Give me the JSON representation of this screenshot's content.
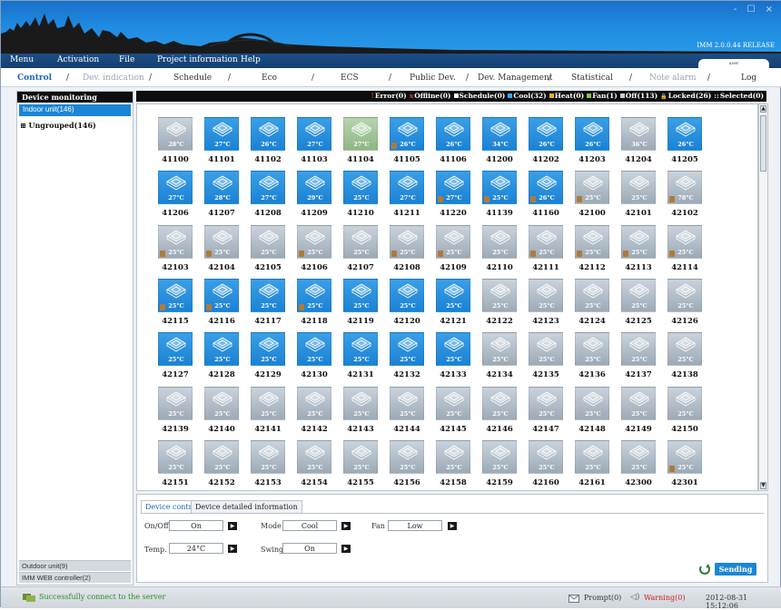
{
  "window": {
    "controls": "- ☐ ×",
    "version": "IMM 2.0.0.44 RELEASE"
  },
  "menu": [
    "Menu",
    "Activation",
    "File",
    "Project information",
    "Help"
  ],
  "user_tab": "user",
  "nav_tabs": [
    {
      "label": "Control",
      "state": "active"
    },
    {
      "label": "Dev. indication",
      "state": "dim"
    },
    {
      "label": "Schedule",
      "state": "normal"
    },
    {
      "label": "Eco",
      "state": "normal"
    },
    {
      "label": "ECS",
      "state": "normal"
    },
    {
      "label": "Public Dev.",
      "state": "normal"
    },
    {
      "label": "Dev. Management",
      "state": "normal"
    },
    {
      "label": "Statistical",
      "state": "normal"
    },
    {
      "label": "Note alarm",
      "state": "dim"
    },
    {
      "label": "Log",
      "state": "normal"
    }
  ],
  "left": {
    "title": "Device monitoring",
    "indoor": "Indoor unit(146)",
    "group": "Ungrouped(146)",
    "outdoor": "Outdoor unit(9)",
    "web": "IMM WEB controller(2)"
  },
  "status": [
    {
      "label": "Error(0)",
      "color": "#e23b3b",
      "glyph": "!"
    },
    {
      "label": "Offline(0)",
      "color": "#e23b3b",
      "glyph": "x"
    },
    {
      "label": "Schedule(0)",
      "color": "#ffffff",
      "glyph": "sq"
    },
    {
      "label": "Cool(32)",
      "color": "#37a8ff",
      "glyph": "sq"
    },
    {
      "label": "Heat(0)",
      "color": "#f0b400",
      "glyph": "sq"
    },
    {
      "label": "Fan(1)",
      "color": "#88c24f",
      "glyph": "sq"
    },
    {
      "label": "Off(113)",
      "color": "#c7ced6",
      "glyph": "sq"
    },
    {
      "label": "Locked(26)",
      "color": "#c79a55",
      "glyph": "lock"
    },
    {
      "label": "Selected(0)",
      "color": "#ffffff",
      "glyph": "dots"
    }
  ],
  "devices": [
    {
      "id": "41100",
      "temp": "28°C",
      "state": "off"
    },
    {
      "id": "41101",
      "temp": "27°C",
      "state": "cool"
    },
    {
      "id": "41102",
      "temp": "26°C",
      "state": "cool"
    },
    {
      "id": "41103",
      "temp": "27°C",
      "state": "cool"
    },
    {
      "id": "41104",
      "temp": "27°C",
      "state": "off2"
    },
    {
      "id": "41105",
      "temp": "26°C",
      "state": "cool",
      "lock": true
    },
    {
      "id": "41106",
      "temp": "26°C",
      "state": "cool"
    },
    {
      "id": "41200",
      "temp": "34°C",
      "state": "cool"
    },
    {
      "id": "41202",
      "temp": "26°C",
      "state": "cool"
    },
    {
      "id": "41203",
      "temp": "26°C",
      "state": "cool"
    },
    {
      "id": "41204",
      "temp": "36°C",
      "state": "off"
    },
    {
      "id": "41205",
      "temp": "26°C",
      "state": "cool"
    },
    {
      "id": "41206",
      "temp": "27°C",
      "state": "cool"
    },
    {
      "id": "41207",
      "temp": "28°C",
      "state": "cool"
    },
    {
      "id": "41208",
      "temp": "27°C",
      "state": "cool"
    },
    {
      "id": "41209",
      "temp": "29°C",
      "state": "cool"
    },
    {
      "id": "41210",
      "temp": "25°C",
      "state": "cool"
    },
    {
      "id": "41211",
      "temp": "27°C",
      "state": "cool"
    },
    {
      "id": "41220",
      "temp": "27°C",
      "state": "cool",
      "lock": true
    },
    {
      "id": "41139",
      "temp": "25°C",
      "state": "cool",
      "lock": true
    },
    {
      "id": "41160",
      "temp": "26°C",
      "state": "cool",
      "lock": true
    },
    {
      "id": "42100",
      "temp": "25°C",
      "state": "off",
      "lock": true
    },
    {
      "id": "42101",
      "temp": "25°C",
      "state": "off"
    },
    {
      "id": "42102",
      "temp": "78°C",
      "state": "off",
      "lock": true
    },
    {
      "id": "42103",
      "temp": "25°C",
      "state": "off",
      "lock": true
    },
    {
      "id": "42104",
      "temp": "25°C",
      "state": "off",
      "lock": true
    },
    {
      "id": "42105",
      "temp": "25°C",
      "state": "off"
    },
    {
      "id": "42106",
      "temp": "25°C",
      "state": "off",
      "lock": true
    },
    {
      "id": "42107",
      "temp": "25°C",
      "state": "off"
    },
    {
      "id": "42108",
      "temp": "25°C",
      "state": "off",
      "lock": true
    },
    {
      "id": "42109",
      "temp": "25°C",
      "state": "off",
      "lock": true
    },
    {
      "id": "42110",
      "temp": "25°C",
      "state": "off"
    },
    {
      "id": "42111",
      "temp": "25°C",
      "state": "off",
      "lock": true
    },
    {
      "id": "42112",
      "temp": "25°C",
      "state": "off",
      "lock": true
    },
    {
      "id": "42113",
      "temp": "25°C",
      "state": "off",
      "lock": true
    },
    {
      "id": "42114",
      "temp": "25°C",
      "state": "off",
      "lock": true
    },
    {
      "id": "42115",
      "temp": "25°C",
      "state": "cool",
      "lock": true
    },
    {
      "id": "42116",
      "temp": "25°C",
      "state": "cool",
      "lock": true
    },
    {
      "id": "42117",
      "temp": "25°C",
      "state": "cool"
    },
    {
      "id": "42118",
      "temp": "25°C",
      "state": "cool",
      "lock": true
    },
    {
      "id": "42119",
      "temp": "25°C",
      "state": "cool"
    },
    {
      "id": "42120",
      "temp": "25°C",
      "state": "cool"
    },
    {
      "id": "42121",
      "temp": "25°C",
      "state": "cool"
    },
    {
      "id": "42122",
      "temp": "25°C",
      "state": "off"
    },
    {
      "id": "42123",
      "temp": "25°C",
      "state": "off"
    },
    {
      "id": "42124",
      "temp": "25°C",
      "state": "off"
    },
    {
      "id": "42125",
      "temp": "25°C",
      "state": "off"
    },
    {
      "id": "42126",
      "temp": "25°C",
      "state": "off"
    },
    {
      "id": "42127",
      "temp": "25°C",
      "state": "cool"
    },
    {
      "id": "42128",
      "temp": "25°C",
      "state": "cool"
    },
    {
      "id": "42129",
      "temp": "25°C",
      "state": "cool"
    },
    {
      "id": "42130",
      "temp": "25°C",
      "state": "cool"
    },
    {
      "id": "42131",
      "temp": "25°C",
      "state": "cool"
    },
    {
      "id": "42132",
      "temp": "25°C",
      "state": "cool"
    },
    {
      "id": "42133",
      "temp": "25°C",
      "state": "cool"
    },
    {
      "id": "42134",
      "temp": "25°C",
      "state": "off"
    },
    {
      "id": "42135",
      "temp": "25°C",
      "state": "off"
    },
    {
      "id": "42136",
      "temp": "25°C",
      "state": "off"
    },
    {
      "id": "42137",
      "temp": "25°C",
      "state": "off"
    },
    {
      "id": "42138",
      "temp": "25°C",
      "state": "off"
    },
    {
      "id": "42139",
      "temp": "25°C",
      "state": "off"
    },
    {
      "id": "42140",
      "temp": "25°C",
      "state": "off"
    },
    {
      "id": "42141",
      "temp": "25°C",
      "state": "off"
    },
    {
      "id": "42142",
      "temp": "25°C",
      "state": "off"
    },
    {
      "id": "42143",
      "temp": "25°C",
      "state": "off"
    },
    {
      "id": "42144",
      "temp": "25°C",
      "state": "off"
    },
    {
      "id": "42145",
      "temp": "25°C",
      "state": "off"
    },
    {
      "id": "42146",
      "temp": "25°C",
      "state": "off"
    },
    {
      "id": "42147",
      "temp": "25°C",
      "state": "off"
    },
    {
      "id": "42148",
      "temp": "25°C",
      "state": "off"
    },
    {
      "id": "42149",
      "temp": "25°C",
      "state": "off"
    },
    {
      "id": "42150",
      "temp": "25°C",
      "state": "off"
    },
    {
      "id": "42151",
      "temp": "25°C",
      "state": "off"
    },
    {
      "id": "42152",
      "temp": "25°C",
      "state": "off"
    },
    {
      "id": "42153",
      "temp": "25°C",
      "state": "off"
    },
    {
      "id": "42154",
      "temp": "25°C",
      "state": "off"
    },
    {
      "id": "42155",
      "temp": "25°C",
      "state": "off"
    },
    {
      "id": "42156",
      "temp": "25°C",
      "state": "off"
    },
    {
      "id": "42158",
      "temp": "25°C",
      "state": "off"
    },
    {
      "id": "42159",
      "temp": "25°C",
      "state": "off"
    },
    {
      "id": "42160",
      "temp": "25°C",
      "state": "off"
    },
    {
      "id": "42161",
      "temp": "25°C",
      "state": "off"
    },
    {
      "id": "42300",
      "temp": "25°C",
      "state": "off"
    },
    {
      "id": "42301",
      "temp": "25°C",
      "state": "off",
      "lock": true
    }
  ],
  "control": {
    "tab_control": "Device control",
    "tab_info": "Device detailed information",
    "onoff_label": "On/Off",
    "onoff_value": "On",
    "mode_label": "Mode",
    "mode_value": "Cool",
    "fan_label": "Fan",
    "fan_value": "Low",
    "temp_label": "Temp.",
    "temp_value": "24°C",
    "swing_label": "Swing",
    "swing_value": "On",
    "send": "Sending"
  },
  "footer": {
    "connection": "Successfully connect to the server",
    "prompt": "Prompt(0)",
    "warning": "Warning(0)",
    "time": "2012-08-31 15:12:06"
  }
}
